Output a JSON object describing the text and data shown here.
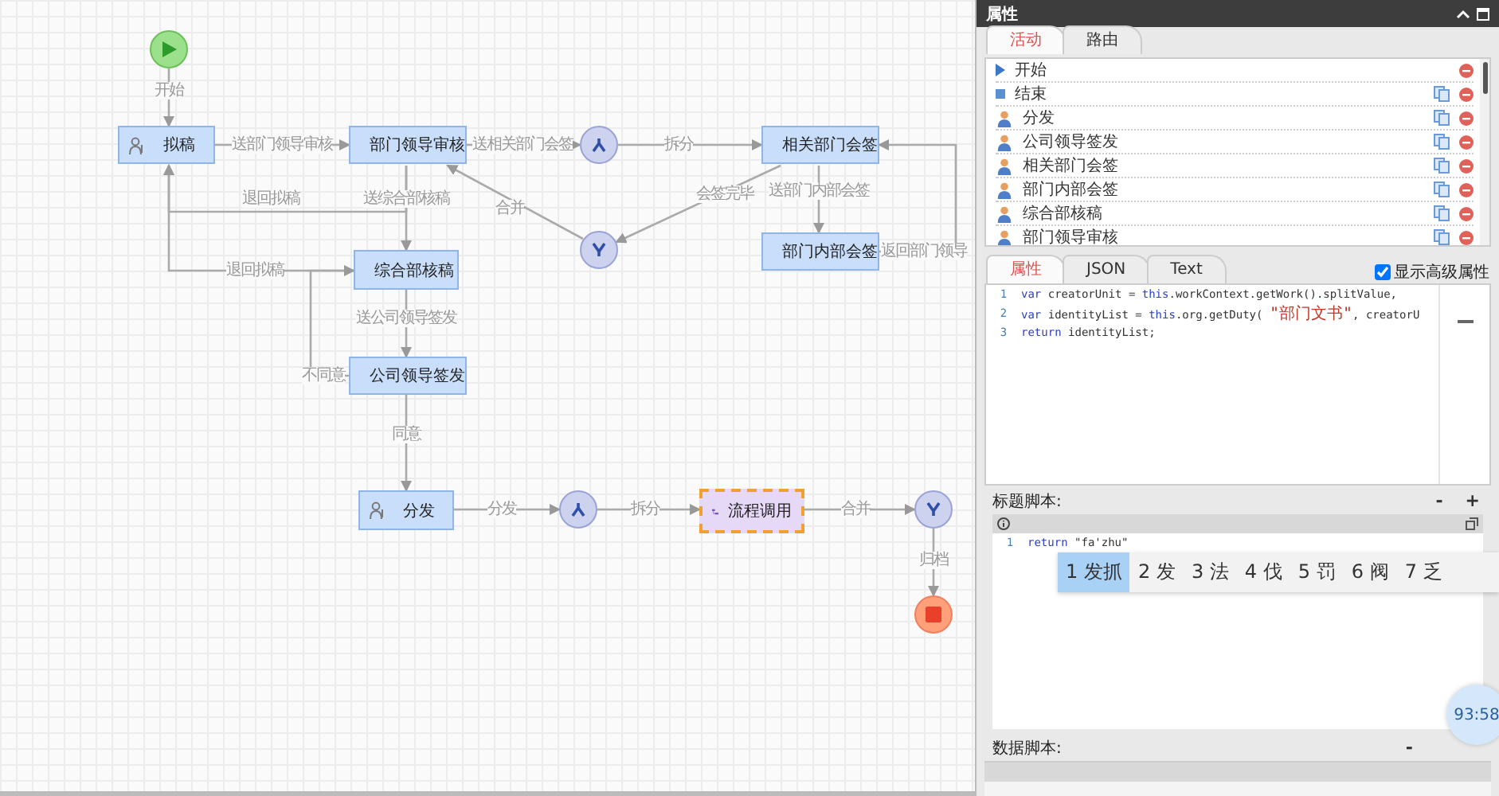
{
  "diagram": {
    "nodes": [
      {
        "kind": "start",
        "selected": false
      },
      {
        "kind": "task",
        "label": "拟稿",
        "selected": false
      },
      {
        "kind": "task",
        "label": "部门领导审核",
        "selected": false
      },
      {
        "kind": "split",
        "selected": false
      },
      {
        "kind": "task",
        "label": "相关部门会签",
        "selected": false
      },
      {
        "kind": "merge",
        "selected": false
      },
      {
        "kind": "task",
        "label": "部门内部会签",
        "selected": false
      },
      {
        "kind": "task",
        "label": "综合部核稿",
        "selected": false
      },
      {
        "kind": "task",
        "label": "公司领导签发",
        "selected": false
      },
      {
        "kind": "task",
        "label": "分发",
        "selected": false
      },
      {
        "kind": "split",
        "selected": false
      },
      {
        "kind": "subprocess",
        "label": "流程调用",
        "selected": true
      },
      {
        "kind": "merge",
        "selected": false
      },
      {
        "kind": "end",
        "selected": false
      }
    ],
    "edges": [
      {
        "label": "开始"
      },
      {
        "label": "送部门领导审核"
      },
      {
        "label": "送相关部门会签"
      },
      {
        "label": "拆分"
      },
      {
        "label": "退回拟稿"
      },
      {
        "label": "送综合部核稿"
      },
      {
        "label": "送部门内部会签"
      },
      {
        "label": "返回部门领导"
      },
      {
        "label": "会签完毕"
      },
      {
        "label": "合并"
      },
      {
        "label": "退回拟稿"
      },
      {
        "label": "送公司领导签发"
      },
      {
        "label": "不同意"
      },
      {
        "label": "同意"
      },
      {
        "label": "分发"
      },
      {
        "label": "拆分"
      },
      {
        "label": "合并"
      },
      {
        "label": "归档"
      }
    ]
  },
  "panel": {
    "title": "属性",
    "top_tabs": [
      {
        "label": "活动",
        "selected": true
      },
      {
        "label": "路由",
        "selected": false
      }
    ],
    "activities": [
      {
        "kind": "start",
        "label": "开始"
      },
      {
        "kind": "end",
        "label": "结束"
      },
      {
        "kind": "manual",
        "label": "分发"
      },
      {
        "kind": "manual",
        "label": "公司领导签发"
      },
      {
        "kind": "manual",
        "label": "相关部门会签"
      },
      {
        "kind": "manual",
        "label": "部门内部会签"
      },
      {
        "kind": "manual",
        "label": "综合部核稿"
      },
      {
        "kind": "manual",
        "label": "部门领导审核"
      }
    ],
    "bottom_tabs": [
      {
        "label": "属性",
        "selected": true
      },
      {
        "label": "JSON",
        "selected": false
      },
      {
        "label": "Text",
        "selected": false
      }
    ],
    "advanced": {
      "label": "显示高级属性",
      "checked": true
    },
    "script_lines": [
      {
        "number": "1",
        "parts": [
          {
            "kind": "keyword",
            "text": "var"
          },
          {
            "kind": "plain",
            "text": " creatorUnit = "
          },
          {
            "kind": "keyword",
            "text": "this"
          },
          {
            "kind": "plain",
            "text": ".workContext.getWork().splitValue,"
          }
        ]
      },
      {
        "number": "2",
        "parts": [
          {
            "kind": "keyword",
            "text": "var"
          },
          {
            "kind": "plain",
            "text": " identityList = "
          },
          {
            "kind": "keyword",
            "text": "this"
          },
          {
            "kind": "plain",
            "text": ".org.getDuty( "
          },
          {
            "kind": "string",
            "text": "\"部门文书\""
          },
          {
            "kind": "plain",
            "text": ", creatorU"
          }
        ]
      },
      {
        "number": "3",
        "parts": [
          {
            "kind": "keyword",
            "text": "return"
          },
          {
            "kind": "plain",
            "text": " identityList;"
          }
        ]
      }
    ],
    "title_script": {
      "label": "标题脚本:",
      "controls": [
        "-",
        "+"
      ],
      "lines": [
        {
          "number": "1",
          "parts": [
            {
              "kind": "keyword",
              "text": "return"
            },
            {
              "kind": "plain",
              "text": " \"fa'zhu\""
            }
          ]
        }
      ]
    },
    "ime": {
      "candidates": [
        {
          "number": "1",
          "text": "发抓",
          "selected": true
        },
        {
          "number": "2",
          "text": "发",
          "selected": false
        },
        {
          "number": "3",
          "text": "法",
          "selected": false
        },
        {
          "number": "4",
          "text": "伐",
          "selected": false
        },
        {
          "number": "5",
          "text": "罚",
          "selected": false
        },
        {
          "number": "6",
          "text": "阀",
          "selected": false
        },
        {
          "number": "7",
          "text": "乏",
          "selected": false
        }
      ]
    },
    "timer": "93:58",
    "data_script": {
      "label": "数据脚本:",
      "controls": [
        "-"
      ]
    }
  }
}
